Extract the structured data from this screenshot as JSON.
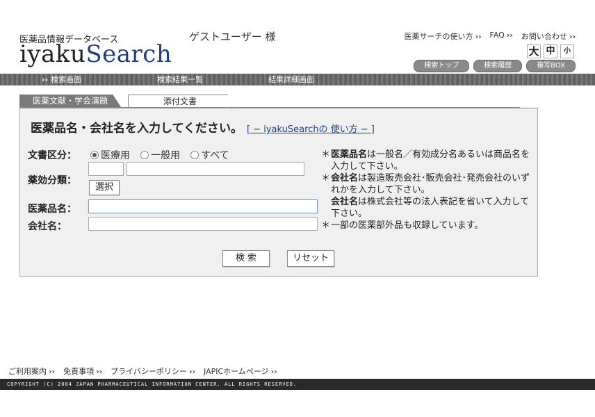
{
  "header": {
    "logo_subtitle": "医薬品情報データベース",
    "logo_prefix": "iyaku",
    "logo_suffix": "Search",
    "user_label": "ゲストユーザー 様",
    "links": [
      {
        "label": "医薬サーチの使い方"
      },
      {
        "label": "FAQ"
      },
      {
        "label": "お問い合わせ"
      }
    ],
    "font_sizes": [
      "大",
      "中",
      "小"
    ],
    "pill_buttons": [
      "検索トップ",
      "検索履歴",
      "複写BOX"
    ]
  },
  "nav": {
    "items": [
      "検索画面",
      "検索結果一覧",
      "結果詳細画面"
    ],
    "arrow": "››"
  },
  "tabs": [
    "医薬文献・学会演題",
    "添付文書"
  ],
  "form": {
    "heading": "医薬品名・会社名を入力してください。",
    "help_link": "[ − iyakuSearchの 使い方 − ]",
    "doc_type_label": "文書区分：",
    "doc_type_options": [
      "医療用",
      "一般用",
      "すべて"
    ],
    "doc_type_selected": "医療用",
    "category_label": "薬効分類：",
    "select_button": "選択",
    "drug_name_label": "医薬品名：",
    "company_label": "会社名：",
    "drug_name_value": "",
    "company_value": "",
    "search_button": "検 索",
    "reset_button": "リセット"
  },
  "notes": [
    {
      "bold": "医薬品名",
      "text": "は一般名／有効成分名あるいは商品名を入力して下さい。",
      "star": true
    },
    {
      "bold": "会社名",
      "text": "は製造販売会社･販売会社･発売会社のいずれかを入力して下さい。",
      "star": true
    },
    {
      "bold": "会社名",
      "text": "は株式会社等の法人表記を省いて入力して下さい。",
      "star": false
    },
    {
      "bold": "",
      "text": "一部の医薬部外品も収録しています。",
      "star": true
    }
  ],
  "footer": {
    "links": [
      "ご利用案内",
      "免責事項",
      "プライバシーポリシー",
      "JAPICホームページ"
    ],
    "copyright": "COPYRIGHT (C) 2004 JAPAN PHARMACEUTICAL INFORMATION CENTER. ALL RIGHTS RESERVED."
  },
  "colors": {
    "accent": "#1a3f88",
    "nav_bg": "#6b6b6b",
    "panel_bg": "#f0f0f0"
  }
}
